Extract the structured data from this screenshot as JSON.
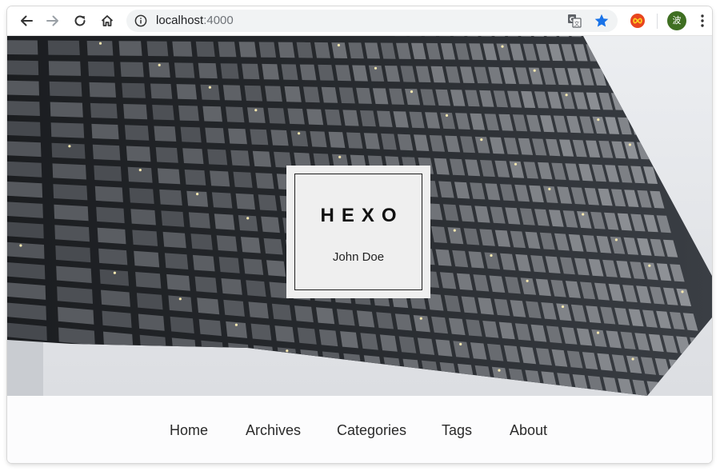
{
  "browser": {
    "url_host": "localhost",
    "url_port": ":4000",
    "profile_initial": "波",
    "accent_color": "#1a73e8",
    "icons": {
      "back": "back-arrow-icon",
      "forward": "forward-arrow-icon",
      "reload": "reload-icon",
      "home": "home-icon",
      "info": "info-icon",
      "translate": "translate-icon",
      "bookmark": "star-icon",
      "extension": "infinity-extension-icon",
      "menu": "kebab-menu-icon"
    }
  },
  "site": {
    "title": "HEXO",
    "author": "John Doe"
  },
  "nav": {
    "items": [
      {
        "label": "Home"
      },
      {
        "label": "Archives"
      },
      {
        "label": "Categories"
      },
      {
        "label": "Tags"
      },
      {
        "label": "About"
      }
    ]
  }
}
